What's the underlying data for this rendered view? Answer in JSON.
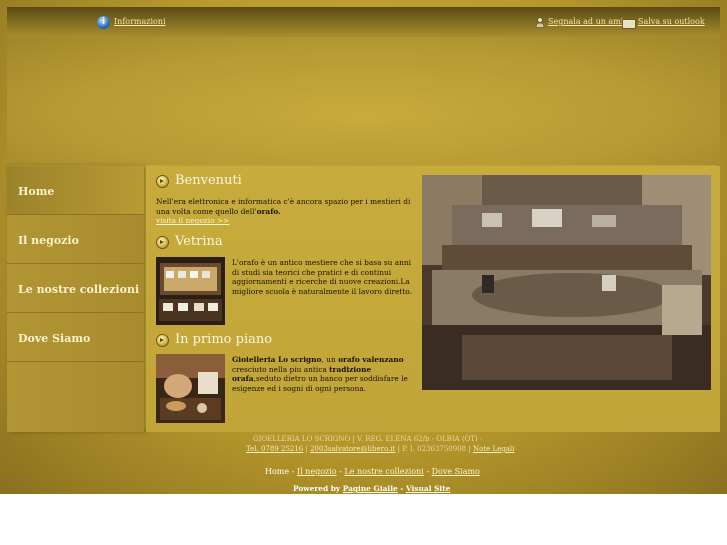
{
  "topbar": {
    "info_label": "Informazioni",
    "friend_label": "Segnala ad un amico",
    "outlook_label": "Salva su outlook",
    "icons": [
      "info-icon",
      "person-icon",
      "card-icon"
    ]
  },
  "nav": {
    "items": [
      {
        "label": "Home"
      },
      {
        "label": "Il negozio"
      },
      {
        "label": "Le nostre collezioni"
      },
      {
        "label": "Dove Siamo"
      }
    ]
  },
  "sections": {
    "benvenuti": {
      "title": "Benvenuti",
      "text_pre": "Nell'era elettronica e informatica c'è ancora spazio per i mestieri di una volta come quello dell'",
      "text_bold": "orafo.",
      "link": "visita il negozio >>"
    },
    "vetrina": {
      "title": "Vetrina",
      "text": "L'orafo è un antico mestiere che si basa su anni di studi sia teorici che pratici e di continui aggiornamenti e ricerche di nuove creazioni.La migliore scuola è naturalmente il lavoro diretto."
    },
    "primo_piano": {
      "title": "In primo piano",
      "bold1": "Gioielleria Lo scrigno",
      "text1": ", un ",
      "bold2": "orafo valenzano",
      "text2": " cresciuto nella piu antica ",
      "bold3": "tradizione orafa",
      "text3": ",seduto dietro un banco  per soddisfare le esigenze ed i sogni di ogni persona."
    }
  },
  "footer": {
    "address": "GIOELLERIA LO SCRIGNO | V. REG. ELENA 62/b - OLBIA (OT) -",
    "tel": "Tel. 0789 25216",
    "email": "2003salvatore@libero.it",
    "piva": " | P. I. 02363750908 | ",
    "note": "Note Legali",
    "sep": " | ",
    "nav_home": "Home",
    "nav_sep": "  -  ",
    "nav_negozio": "Il negozio",
    "nav_collezioni": "Le nostre collezioni",
    "nav_dove": "Dove Siamo",
    "powered_by": "Powered by ",
    "pagine_gialle": "Pagine Gialle",
    "dash": " - ",
    "visual_site": "Visual Site"
  }
}
